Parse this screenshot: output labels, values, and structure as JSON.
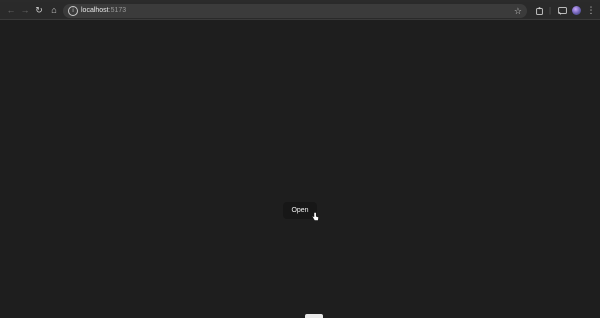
{
  "browser": {
    "url_host": "localhost",
    "url_port": ":5173",
    "icons": {
      "back": "arrow-left-icon",
      "forward": "arrow-right-icon",
      "reload": "reload-icon",
      "home": "home-icon",
      "site_info": "site-info-icon",
      "bookmark": "star-icon",
      "extensions": "puzzle-icon",
      "cast": "cast-icon",
      "profile": "avatar",
      "menu": "kebab-menu-icon"
    },
    "colors": {
      "toolbar": "#2a2a2a",
      "omnibox": "#3b3b3b",
      "page_background": "#1e1e1e"
    }
  },
  "page": {
    "open_button_label": "Open"
  }
}
